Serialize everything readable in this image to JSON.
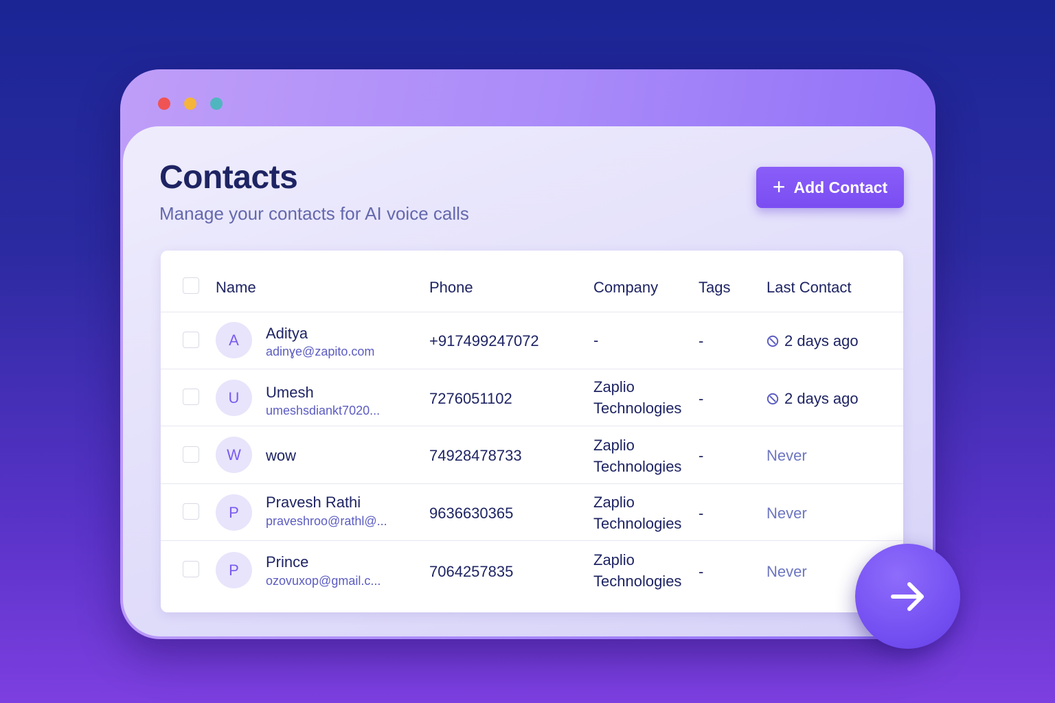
{
  "window_dots": [
    {
      "name": "close-dot",
      "color": "#f05353"
    },
    {
      "name": "minimize-dot",
      "color": "#f5b43a"
    },
    {
      "name": "maximize-dot",
      "color": "#4fb6bf"
    }
  ],
  "header": {
    "title": "Contacts",
    "subtitle": "Manage your contacts for AI voice calls",
    "add_button_label": "Add Contact",
    "add_button_icon": "plus-icon"
  },
  "table": {
    "columns": [
      "Name",
      "Phone",
      "Company",
      "Tags",
      "Last Contact"
    ],
    "rows": [
      {
        "initial": "A",
        "name": "Aditya",
        "email": "adinɣe@zapito.com",
        "phone": "+917499247072",
        "company": [
          "-"
        ],
        "tags": "-",
        "last_contact": "2 days ago",
        "last_contact_icon": "clock-icon"
      },
      {
        "initial": "U",
        "name": "Umesh",
        "email": "umeshsdiankt7020...",
        "phone": "7276051102",
        "company": [
          "Zaplio",
          "Technologies"
        ],
        "tags": "-",
        "last_contact": "2 days ago",
        "last_contact_icon": "clock-icon"
      },
      {
        "initial": "W",
        "name": "wow",
        "email": "",
        "phone": "74928478733",
        "company": [
          "Zaplio",
          "Technologies"
        ],
        "tags": "-",
        "last_contact": "Never"
      },
      {
        "initial": "P",
        "name": "Pravesh Rathi",
        "email": "praveshroo@rathl@...",
        "phone": "9636630365",
        "company": [
          "Zaplio",
          "Technologies"
        ],
        "tags": "-",
        "last_contact": "Never"
      },
      {
        "initial": "P",
        "name": "Prince",
        "email": "ozovuxop@gmail.c...",
        "phone": "7064257835",
        "company": [
          "Zaplio",
          "Technologies"
        ],
        "tags": "-",
        "last_contact": "Never"
      }
    ]
  },
  "fab": {
    "icon": "arrow-right-icon"
  },
  "colors": {
    "accent": "#7a4df2",
    "title": "#1e2463",
    "email": "#5c5cc2",
    "never": "#6d76c0"
  }
}
